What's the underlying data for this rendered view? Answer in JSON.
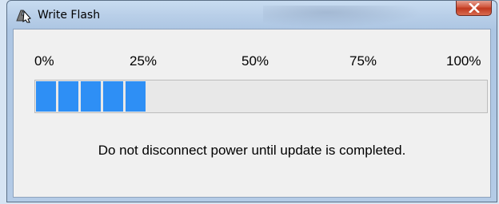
{
  "window": {
    "title": "Write Flash",
    "app_icon": "flash-writer-icon",
    "close_icon": "close-icon"
  },
  "progress": {
    "scale_labels": [
      "0%",
      "25%",
      "50%",
      "75%",
      "100%"
    ],
    "fraction": 0.25,
    "segments_filled": 5,
    "fill_color": "#2e8ff5",
    "track_color": "#e8e8e8"
  },
  "message": "Do not disconnect power until update is completed."
}
